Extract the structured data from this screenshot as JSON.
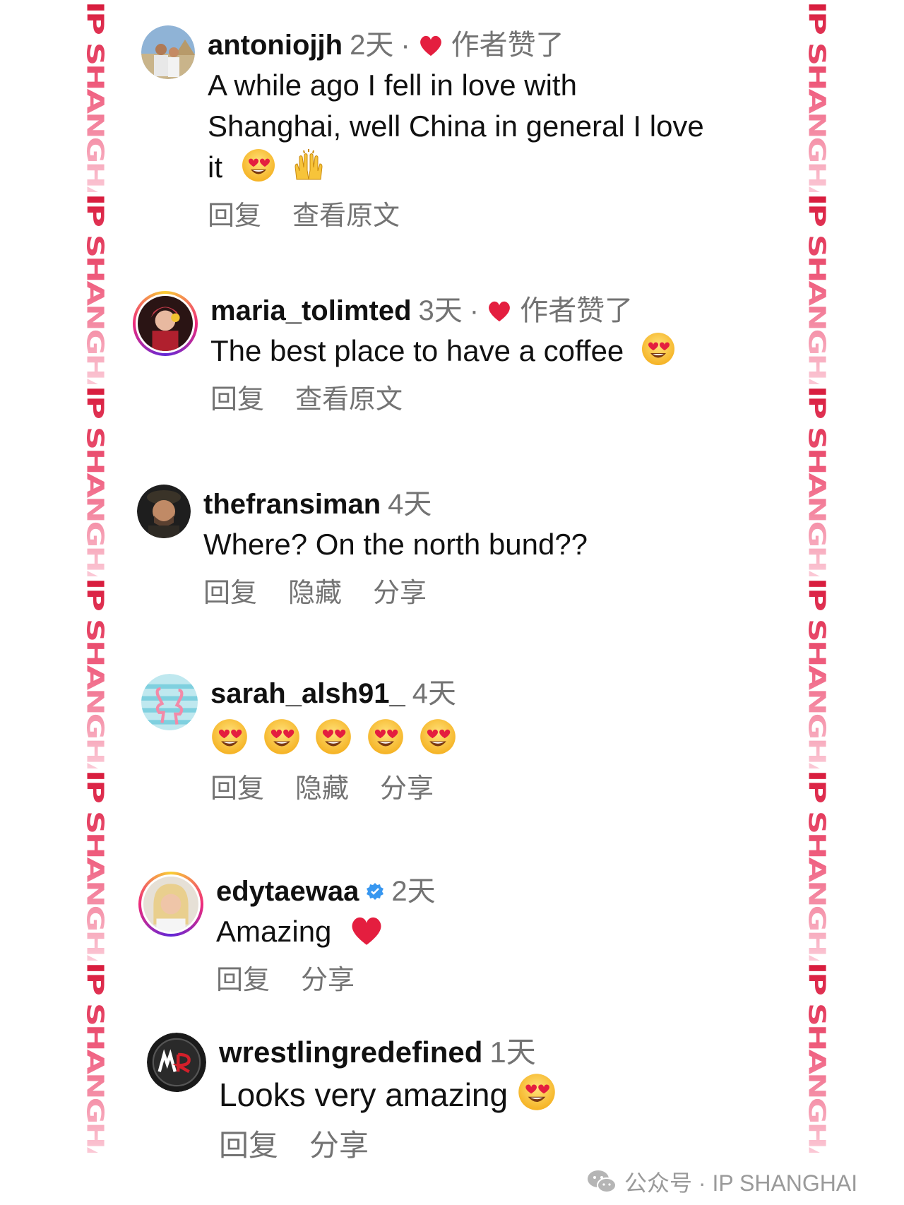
{
  "watermark": "IP SHANGHAI",
  "actions": {
    "reply": "回复",
    "view_original": "查看原文",
    "hide": "隐藏",
    "share": "分享"
  },
  "separator": "·",
  "liked_by_author": "作者赞了",
  "comments": [
    {
      "username": "antoniojjh",
      "time": "2天",
      "text_lines": [
        "A while ago I fell in love with",
        "Shanghai, well China in general I love",
        "it"
      ]
    },
    {
      "username": "maria_tolimted",
      "time": "3天",
      "text": "The best place to have a coffee"
    },
    {
      "username": "thefransiman",
      "time": "4天",
      "text": "Where? On the north bund??"
    },
    {
      "username": "sarah_alsh91_",
      "time": "4天"
    },
    {
      "username": "edytaewaa",
      "time": "2天",
      "text": "Amazing"
    },
    {
      "username": "wrestlingredefined",
      "time": "1天",
      "text": "Looks very amazing"
    }
  ],
  "footer": {
    "text": "公众号 · IP SHANGHAI"
  },
  "colors": {
    "heart": "#e41e3f",
    "meta": "#737373",
    "verified": "#3897f0",
    "watermark": "#d7193a"
  }
}
